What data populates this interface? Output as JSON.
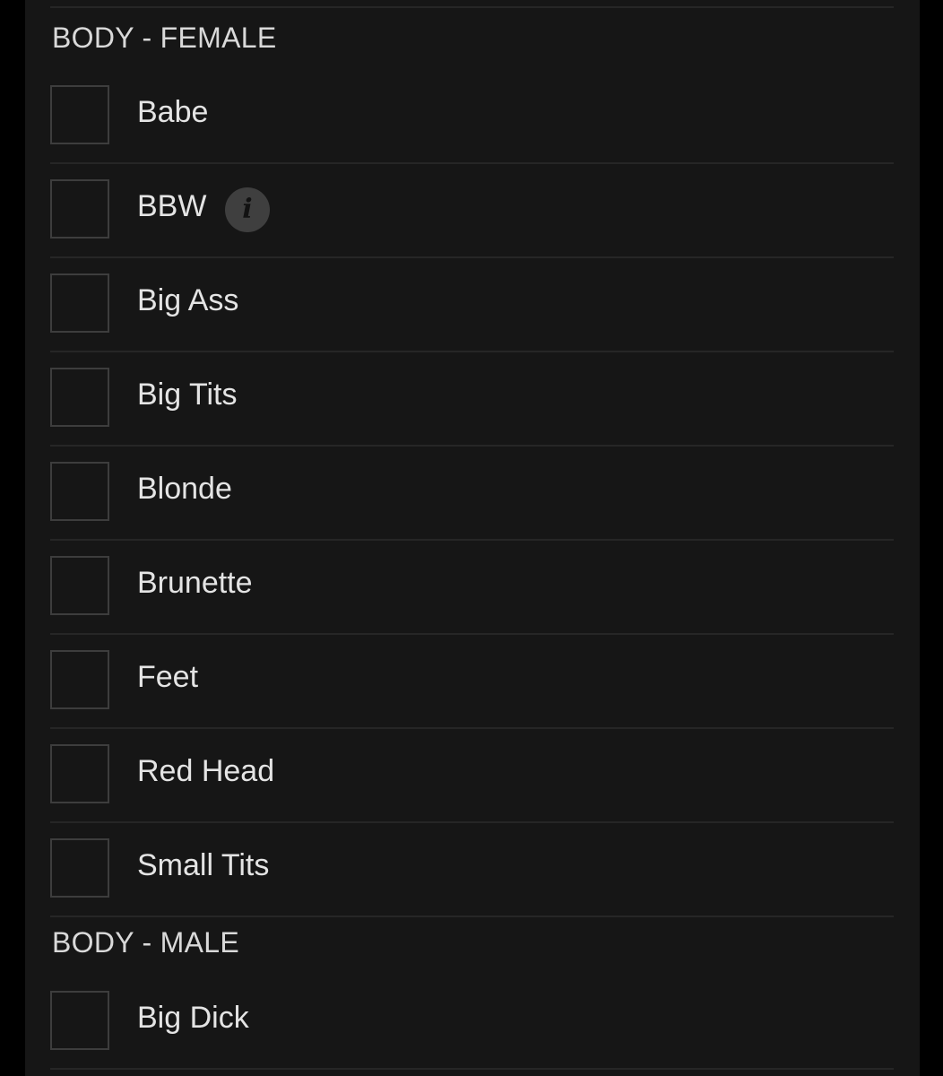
{
  "sections": [
    {
      "heading": "BODY - FEMALE",
      "options": [
        {
          "label": "Babe",
          "checked": false
        },
        {
          "label": "BBW",
          "checked": false,
          "has_info": true,
          "info_glyph": "i",
          "info_icon": "info-icon"
        },
        {
          "label": "Big Ass",
          "checked": false
        },
        {
          "label": "Big Tits",
          "checked": false
        },
        {
          "label": "Blonde",
          "checked": false
        },
        {
          "label": "Brunette",
          "checked": false
        },
        {
          "label": "Feet",
          "checked": false
        },
        {
          "label": "Red Head",
          "checked": false
        },
        {
          "label": "Small Tits",
          "checked": false
        }
      ]
    },
    {
      "heading": "BODY - MALE",
      "options": [
        {
          "label": "Big Dick",
          "checked": false
        }
      ]
    }
  ],
  "colors": {
    "page_background": "#000000",
    "panel_background": "#161616",
    "divider": "#262626",
    "checkbox_border": "#3d3d3d",
    "text": "#e4e4e4",
    "info_icon_background": "#3f3f3f"
  }
}
